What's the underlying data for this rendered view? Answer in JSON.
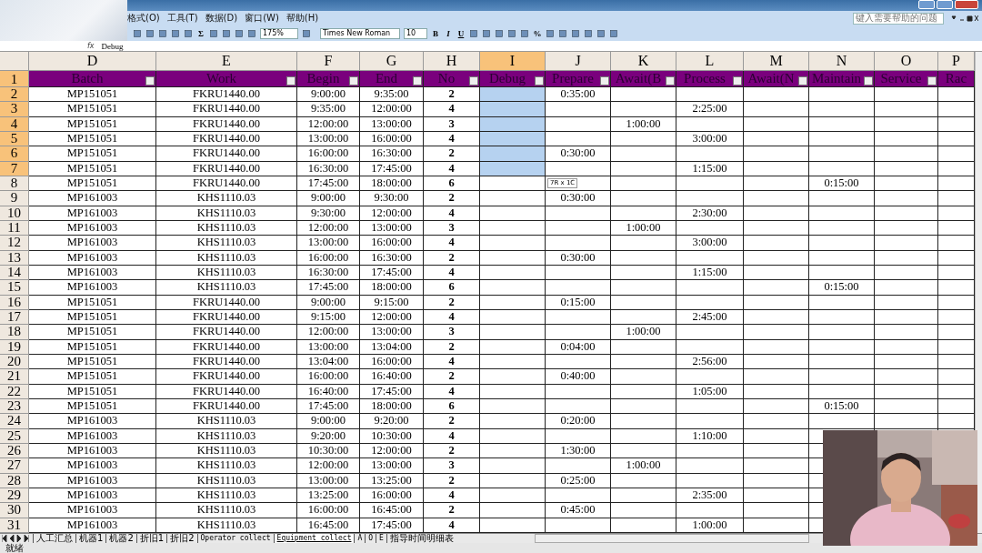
{
  "menu": [
    {
      "label": "格式(O)"
    },
    {
      "label": "工具(T)"
    },
    {
      "label": "数据(D)"
    },
    {
      "label": "窗口(W)"
    },
    {
      "label": "帮助(H)"
    }
  ],
  "help_search": {
    "placeholder": "键入需要帮助的问题"
  },
  "toolbar": {
    "zoom": "175%",
    "font": "Times New Roman",
    "font_size": "10",
    "sum": "Σ",
    "bold": "B",
    "italic": "I",
    "underline": "U",
    "percent": "%"
  },
  "formula_bar": {
    "fx": "fx",
    "value": "Debug"
  },
  "columns": [
    {
      "letter": "D",
      "header": "Batch",
      "selected": false
    },
    {
      "letter": "E",
      "header": "Work",
      "selected": false
    },
    {
      "letter": "F",
      "header": "Begin",
      "selected": false
    },
    {
      "letter": "G",
      "header": "End",
      "selected": false
    },
    {
      "letter": "H",
      "header": "No",
      "selected": false
    },
    {
      "letter": "I",
      "header": "Debug",
      "selected": true
    },
    {
      "letter": "J",
      "header": "Prepare",
      "selected": false
    },
    {
      "letter": "K",
      "header": "Await(B",
      "selected": false
    },
    {
      "letter": "L",
      "header": "Process",
      "selected": false
    },
    {
      "letter": "M",
      "header": "Await(N",
      "selected": false
    },
    {
      "letter": "N",
      "header": "Maintain",
      "selected": false
    },
    {
      "letter": "O",
      "header": "Service",
      "selected": false
    },
    {
      "letter": "P",
      "header": "Rac",
      "selected": false
    }
  ],
  "header_row": {
    "num": "1",
    "selected": true
  },
  "rows": [
    {
      "num": "2",
      "selected": true,
      "cells": [
        "MP151051",
        "FKRU1440.00",
        "9:00:00",
        "9:35:00",
        "2",
        null,
        "0:35:00",
        null,
        null,
        null,
        null,
        null,
        null
      ]
    },
    {
      "num": "3",
      "selected": true,
      "cells": [
        "MP151051",
        "FKRU1440.00",
        "9:35:00",
        "12:00:00",
        "4",
        null,
        null,
        null,
        "2:25:00",
        null,
        null,
        null,
        null
      ]
    },
    {
      "num": "4",
      "selected": true,
      "cells": [
        "MP151051",
        "FKRU1440.00",
        "12:00:00",
        "13:00:00",
        "3",
        null,
        null,
        "1:00:00",
        null,
        null,
        null,
        null,
        null
      ]
    },
    {
      "num": "5",
      "selected": true,
      "cells": [
        "MP151051",
        "FKRU1440.00",
        "13:00:00",
        "16:00:00",
        "4",
        null,
        null,
        null,
        "3:00:00",
        null,
        null,
        null,
        null
      ]
    },
    {
      "num": "6",
      "selected": true,
      "cells": [
        "MP151051",
        "FKRU1440.00",
        "16:00:00",
        "16:30:00",
        "2",
        null,
        "0:30:00",
        null,
        null,
        null,
        null,
        null,
        null
      ]
    },
    {
      "num": "7",
      "selected": true,
      "cells": [
        "MP151051",
        "FKRU1440.00",
        "16:30:00",
        "17:45:00",
        "4",
        null,
        null,
        null,
        "1:15:00",
        null,
        null,
        null,
        null
      ]
    },
    {
      "num": "8",
      "selected": false,
      "cells": [
        "MP151051",
        "FKRU1440.00",
        "17:45:00",
        "18:00:00",
        "6",
        null,
        null,
        null,
        null,
        null,
        "0:15:00",
        null,
        null
      ]
    },
    {
      "num": "9",
      "selected": false,
      "cells": [
        "MP161003",
        "KHS1110.03",
        "9:00:00",
        "9:30:00",
        "2",
        null,
        "0:30:00",
        null,
        null,
        null,
        null,
        null,
        null
      ]
    },
    {
      "num": "10",
      "selected": false,
      "cells": [
        "MP161003",
        "KHS1110.03",
        "9:30:00",
        "12:00:00",
        "4",
        null,
        null,
        null,
        "2:30:00",
        null,
        null,
        null,
        null
      ]
    },
    {
      "num": "11",
      "selected": false,
      "cells": [
        "MP161003",
        "KHS1110.03",
        "12:00:00",
        "13:00:00",
        "3",
        null,
        null,
        "1:00:00",
        null,
        null,
        null,
        null,
        null
      ]
    },
    {
      "num": "12",
      "selected": false,
      "cells": [
        "MP161003",
        "KHS1110.03",
        "13:00:00",
        "16:00:00",
        "4",
        null,
        null,
        null,
        "3:00:00",
        null,
        null,
        null,
        null
      ]
    },
    {
      "num": "13",
      "selected": false,
      "cells": [
        "MP161003",
        "KHS1110.03",
        "16:00:00",
        "16:30:00",
        "2",
        null,
        "0:30:00",
        null,
        null,
        null,
        null,
        null,
        null
      ]
    },
    {
      "num": "14",
      "selected": false,
      "cells": [
        "MP161003",
        "KHS1110.03",
        "16:30:00",
        "17:45:00",
        "4",
        null,
        null,
        null,
        "1:15:00",
        null,
        null,
        null,
        null
      ]
    },
    {
      "num": "15",
      "selected": false,
      "cells": [
        "MP161003",
        "KHS1110.03",
        "17:45:00",
        "18:00:00",
        "6",
        null,
        null,
        null,
        null,
        null,
        "0:15:00",
        null,
        null
      ]
    },
    {
      "num": "16",
      "selected": false,
      "cells": [
        "MP151051",
        "FKRU1440.00",
        "9:00:00",
        "9:15:00",
        "2",
        null,
        "0:15:00",
        null,
        null,
        null,
        null,
        null,
        null
      ]
    },
    {
      "num": "17",
      "selected": false,
      "cells": [
        "MP151051",
        "FKRU1440.00",
        "9:15:00",
        "12:00:00",
        "4",
        null,
        null,
        null,
        "2:45:00",
        null,
        null,
        null,
        null
      ]
    },
    {
      "num": "18",
      "selected": false,
      "cells": [
        "MP151051",
        "FKRU1440.00",
        "12:00:00",
        "13:00:00",
        "3",
        null,
        null,
        "1:00:00",
        null,
        null,
        null,
        null,
        null
      ]
    },
    {
      "num": "19",
      "selected": false,
      "cells": [
        "MP151051",
        "FKRU1440.00",
        "13:00:00",
        "13:04:00",
        "2",
        null,
        "0:04:00",
        null,
        null,
        null,
        null,
        null,
        null
      ]
    },
    {
      "num": "20",
      "selected": false,
      "cells": [
        "MP151051",
        "FKRU1440.00",
        "13:04:00",
        "16:00:00",
        "4",
        null,
        null,
        null,
        "2:56:00",
        null,
        null,
        null,
        null
      ]
    },
    {
      "num": "21",
      "selected": false,
      "cells": [
        "MP151051",
        "FKRU1440.00",
        "16:00:00",
        "16:40:00",
        "2",
        null,
        "0:40:00",
        null,
        null,
        null,
        null,
        null,
        null
      ]
    },
    {
      "num": "22",
      "selected": false,
      "cells": [
        "MP151051",
        "FKRU1440.00",
        "16:40:00",
        "17:45:00",
        "4",
        null,
        null,
        null,
        "1:05:00",
        null,
        null,
        null,
        null
      ]
    },
    {
      "num": "23",
      "selected": false,
      "cells": [
        "MP151051",
        "FKRU1440.00",
        "17:45:00",
        "18:00:00",
        "6",
        null,
        null,
        null,
        null,
        null,
        "0:15:00",
        null,
        null
      ]
    },
    {
      "num": "24",
      "selected": false,
      "cells": [
        "MP161003",
        "KHS1110.03",
        "9:00:00",
        "9:20:00",
        "2",
        null,
        "0:20:00",
        null,
        null,
        null,
        null,
        null,
        null
      ]
    },
    {
      "num": "25",
      "selected": false,
      "cells": [
        "MP161003",
        "KHS1110.03",
        "9:20:00",
        "10:30:00",
        "4",
        null,
        null,
        null,
        "1:10:00",
        null,
        null,
        null,
        null
      ]
    },
    {
      "num": "26",
      "selected": false,
      "cells": [
        "MP161003",
        "KHS1110.03",
        "10:30:00",
        "12:00:00",
        "2",
        null,
        "1:30:00",
        null,
        null,
        null,
        null,
        null,
        null
      ]
    },
    {
      "num": "27",
      "selected": false,
      "cells": [
        "MP161003",
        "KHS1110.03",
        "12:00:00",
        "13:00:00",
        "3",
        null,
        null,
        "1:00:00",
        null,
        null,
        null,
        null,
        null
      ]
    },
    {
      "num": "28",
      "selected": false,
      "cells": [
        "MP161003",
        "KHS1110.03",
        "13:00:00",
        "13:25:00",
        "2",
        null,
        "0:25:00",
        null,
        null,
        null,
        null,
        null,
        null
      ]
    },
    {
      "num": "29",
      "selected": false,
      "cells": [
        "MP161003",
        "KHS1110.03",
        "13:25:00",
        "16:00:00",
        "4",
        null,
        null,
        null,
        "2:35:00",
        null,
        null,
        null,
        null
      ]
    },
    {
      "num": "30",
      "selected": false,
      "cells": [
        "MP161003",
        "KHS1110.03",
        "16:00:00",
        "16:45:00",
        "2",
        null,
        "0:45:00",
        null,
        null,
        null,
        null,
        null,
        null
      ]
    },
    {
      "num": "31",
      "selected": false,
      "cells": [
        "MP161003",
        "KHS1110.03",
        "16:45:00",
        "17:45:00",
        "4",
        null,
        null,
        null,
        "1:00:00",
        null,
        null,
        null,
        null
      ]
    }
  ],
  "selection_tooltip": {
    "text": "7R x 1C"
  },
  "sheet_tabs": [
    {
      "label": "人工汇总",
      "selected": false
    },
    {
      "label": "机器1",
      "selected": false
    },
    {
      "label": "机器2",
      "selected": false
    },
    {
      "label": "折旧1",
      "selected": false
    },
    {
      "label": "折旧2",
      "selected": false
    },
    {
      "label": "Operator collect",
      "selected": false
    },
    {
      "label": "Equipment collect",
      "selected": true
    },
    {
      "label": "A",
      "selected": false
    },
    {
      "label": "O",
      "selected": false
    },
    {
      "label": "E",
      "selected": false
    },
    {
      "label": "指导时间明细表",
      "selected": false
    }
  ],
  "status_bar": {
    "text": "就绪"
  }
}
